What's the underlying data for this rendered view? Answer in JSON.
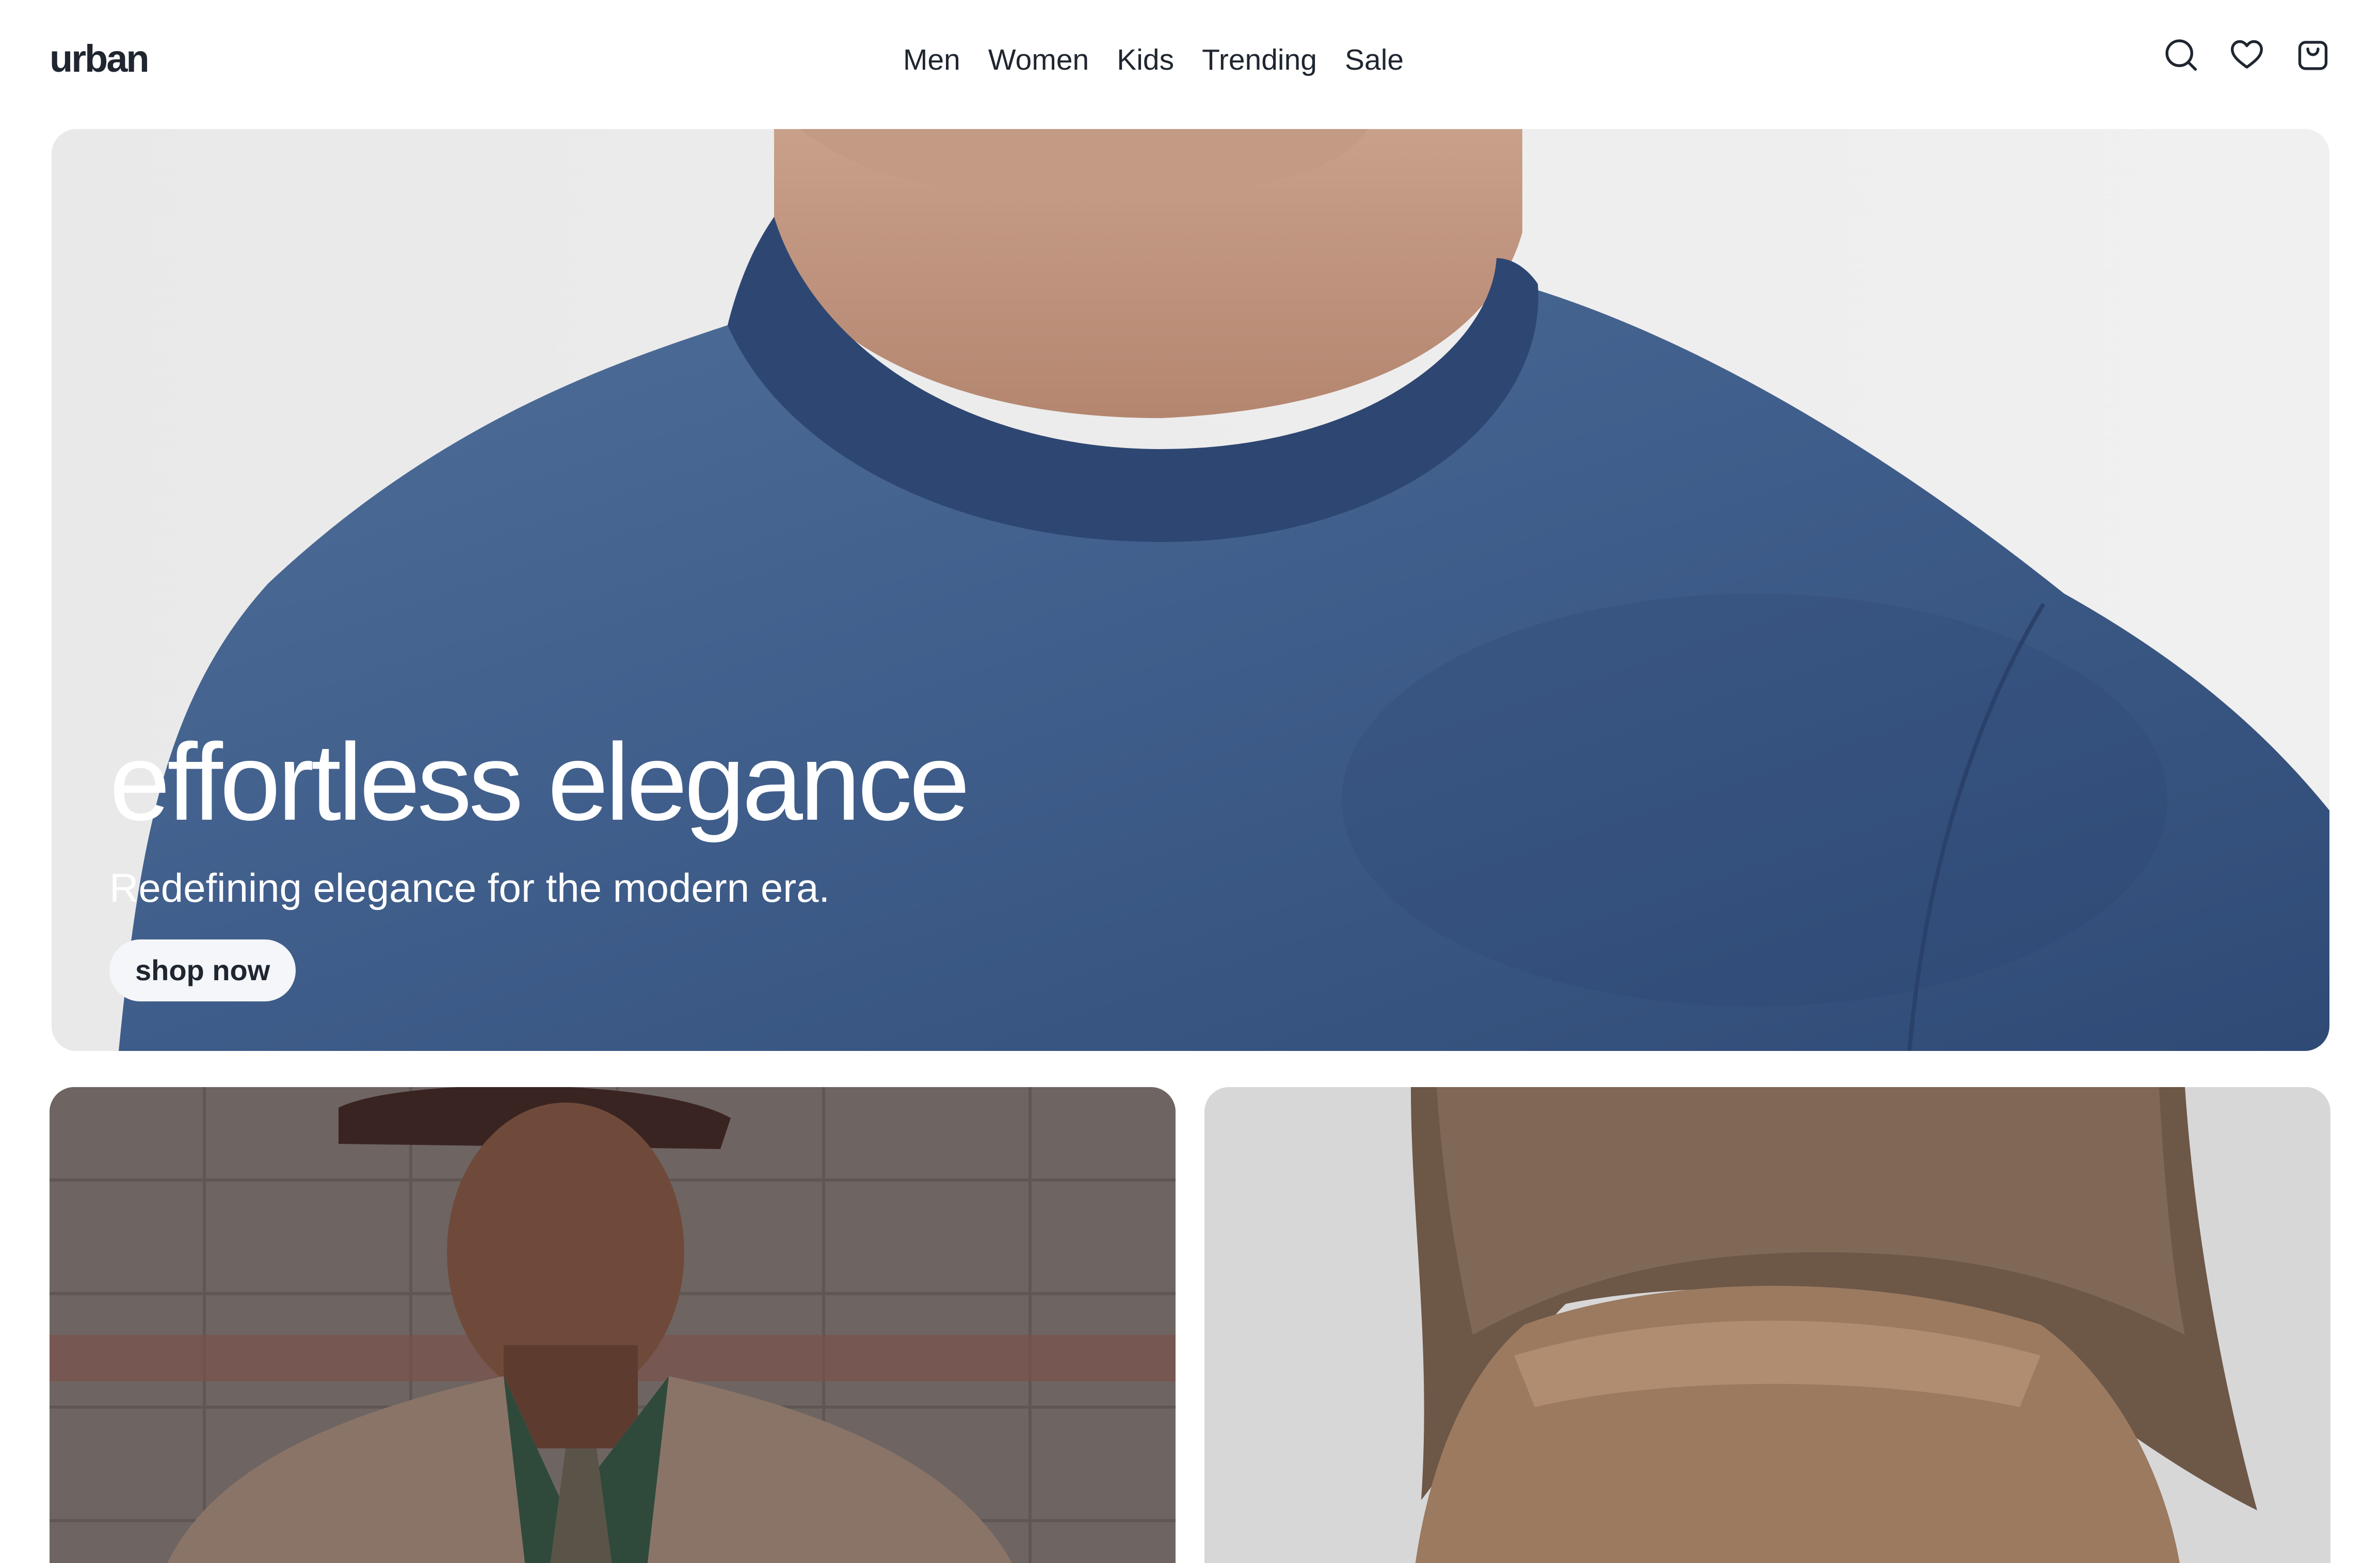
{
  "brand": {
    "logo": "urban"
  },
  "nav": {
    "items": [
      {
        "label": "Men"
      },
      {
        "label": "Women"
      },
      {
        "label": "Kids"
      },
      {
        "label": "Trending"
      },
      {
        "label": "Sale"
      }
    ]
  },
  "header_icons": [
    "search-icon",
    "heart-icon",
    "shopping-bag-icon"
  ],
  "hero": {
    "title": "effortless elegance",
    "subtitle": "Redefining elegance for the modern era.",
    "cta_label": "shop now"
  },
  "colors": {
    "text": "#1f2630",
    "background": "#ffffff",
    "hero_shirt": "#3d5a86",
    "button_bg": "#f4f6f9"
  }
}
